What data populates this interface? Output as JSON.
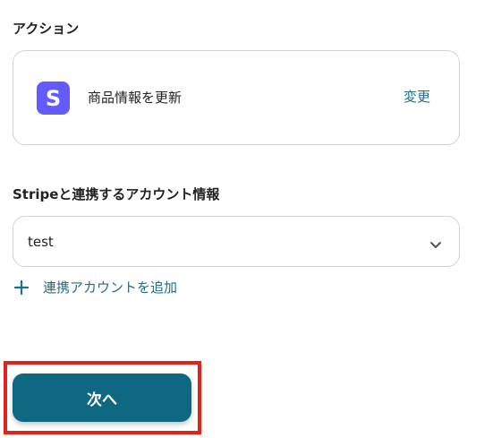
{
  "sections": {
    "action_label": "アクション",
    "account_label": "Stripeと連携するアカウント情報"
  },
  "action": {
    "app_icon": "stripe-s-icon",
    "app_icon_color": "#635bff",
    "name": "商品情報を更新",
    "change_label": "変更"
  },
  "account_select": {
    "value": "test",
    "icon": "chevron-down-icon"
  },
  "add_account": {
    "icon": "plus-icon",
    "label": "連携アカウントを追加"
  },
  "next_button": {
    "label": "次へ",
    "color": "#0f6882"
  },
  "colors": {
    "link": "#1f6e86",
    "highlight": "#e2231a",
    "border": "#d4d4d4"
  }
}
